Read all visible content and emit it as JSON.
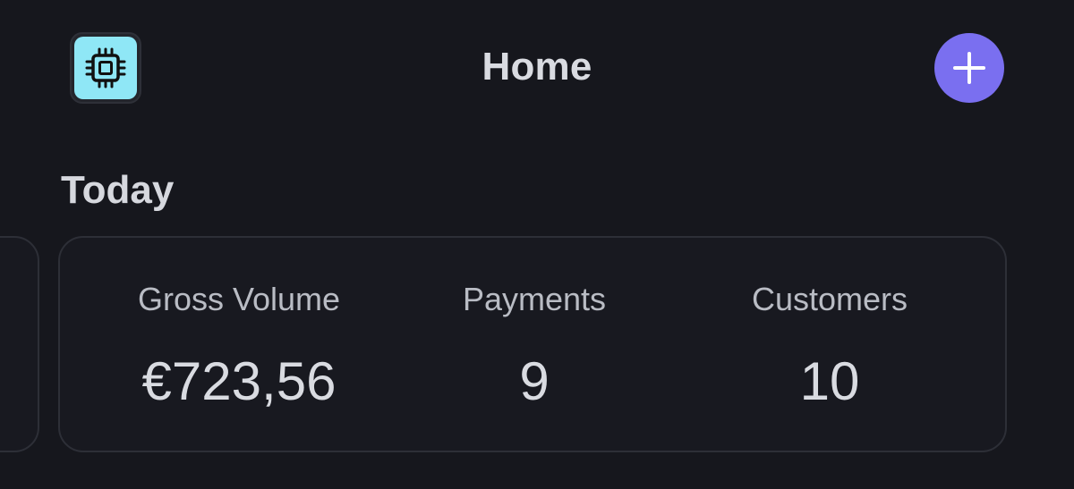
{
  "header": {
    "title": "Home",
    "app_icon": "cpu-chip-icon",
    "add_icon": "plus-icon"
  },
  "today": {
    "title": "Today",
    "stats": {
      "gross_volume": {
        "label": "Gross Volume",
        "value": "€723,56"
      },
      "payments": {
        "label": "Payments",
        "value": "9"
      },
      "customers": {
        "label": "Customers",
        "value": "10"
      }
    }
  },
  "colors": {
    "background": "#16171d",
    "card_border": "#2d2f37",
    "accent": "#7a6ff0",
    "app_icon_bg": "#8fe7f6",
    "text_primary": "#d9dbe1",
    "text_secondary": "#b9bcc4"
  }
}
